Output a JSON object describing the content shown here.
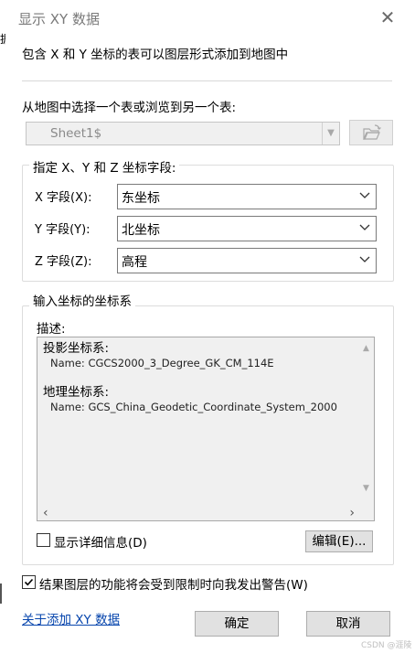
{
  "window": {
    "title": "显示 XY 数据",
    "close_label": "✕",
    "left_edge_text": "据("
  },
  "intro_text": "包含 X 和 Y 坐标的表可以图层形式添加到地图中",
  "table_picker": {
    "label": "从地图中选择一个表或浏览到另一个表:",
    "value": "Sheet1$"
  },
  "fields_group": {
    "title": "指定 X、Y 和 Z 坐标字段:",
    "x": {
      "label": "X 字段(X):",
      "value": "东坐标"
    },
    "y": {
      "label": "Y 字段(Y):",
      "value": "北坐标"
    },
    "z": {
      "label": "Z 字段(Z):",
      "value": "高程"
    }
  },
  "coord_group": {
    "title": "输入坐标的坐标系",
    "desc_label": "描述:",
    "projected_title": "投影坐标系:",
    "projected_name": "Name: CGCS2000_3_Degree_GK_CM_114E",
    "geographic_title": "地理坐标系:",
    "geographic_name": "Name: GCS_China_Geodetic_Coordinate_System_2000",
    "show_details_label": "显示详细信息(D)",
    "show_details_checked": false,
    "edit_button": "编辑(E)..."
  },
  "warn": {
    "label": "结果图层的功能将会受到限制时向我发出警告(W)",
    "checked": true
  },
  "footer": {
    "about_link": "关于添加 XY 数据",
    "ok": "确定",
    "cancel": "取消",
    "watermark": "CSDN @涯陵"
  }
}
